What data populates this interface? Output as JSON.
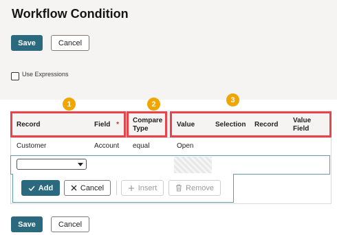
{
  "page": {
    "title": "Workflow Condition"
  },
  "toolbar": {
    "save_label": "Save",
    "cancel_label": "Cancel"
  },
  "options": {
    "use_expressions_label": "Use Expressions",
    "use_expressions_checked": false
  },
  "annotations": [
    "1",
    "2",
    "3"
  ],
  "table": {
    "headers": {
      "record": "Record",
      "field": "Field",
      "field_required": "*",
      "compare_type_line1": "Compare",
      "compare_type_line2": "Type",
      "value": "Value",
      "selection": "Selection",
      "record2": "Record",
      "value_field_line1": "Value",
      "value_field_line2": "Field"
    },
    "rows": [
      {
        "record": "Customer",
        "field": "Account",
        "compare_type": "equal",
        "value": "Open"
      }
    ],
    "edit_row": {
      "record_select_value": ""
    },
    "row_actions": {
      "add": "Add",
      "cancel": "Cancel",
      "insert": "Insert",
      "remove": "Remove"
    }
  },
  "footer": {
    "save_label": "Save",
    "cancel_label": "Cancel"
  },
  "colors": {
    "primary": "#2b6a7e",
    "annotation_box": "#e8434a",
    "annotation_badge": "#f0a500"
  }
}
